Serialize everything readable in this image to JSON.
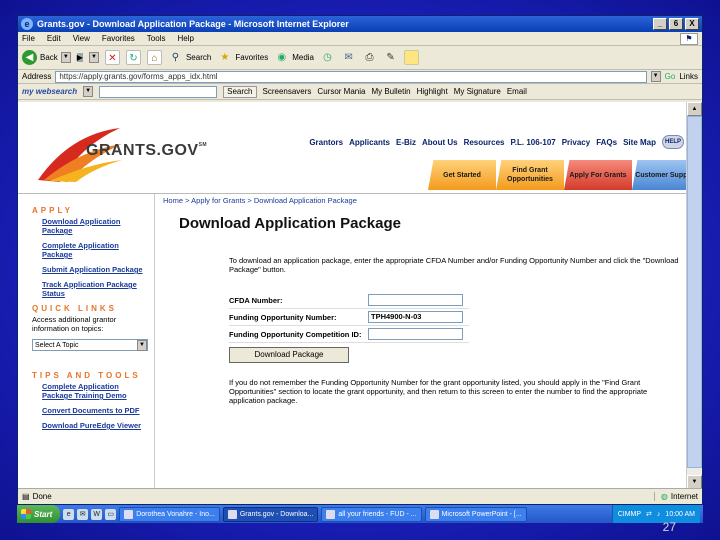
{
  "window": {
    "title": "Grants.gov - Download Application Package - Microsoft Internet Explorer",
    "minimize": "_",
    "restore": "6",
    "close": "X"
  },
  "menu": [
    "File",
    "Edit",
    "View",
    "Favorites",
    "Tools",
    "Help"
  ],
  "toolbar": {
    "back": "Back",
    "search": "Search",
    "favorites": "Favorites",
    "media": "Media"
  },
  "address": {
    "label": "Address",
    "url": "https://apply.grants.gov/forms_apps_idx.html",
    "go": "Go",
    "links": "Links"
  },
  "links_toolbar": {
    "websearch": "my websearch",
    "search_btn": "Search",
    "items": [
      "Screensavers",
      "Cursor Mania",
      "My Bulletin",
      "Highlight",
      "My Signature",
      "Email"
    ]
  },
  "site": {
    "logo_text": "GRANTS.GOV",
    "logo_mark": "SM",
    "topnav": [
      "Grantors",
      "Applicants",
      "E-Biz",
      "About Us",
      "Resources",
      "P.L. 106-107",
      "Privacy",
      "FAQs",
      "Site Map"
    ],
    "help": "HELP",
    "tabs": [
      {
        "label": "Get Started",
        "color": "#f39a1d"
      },
      {
        "label": "Find Grant Opportunities",
        "color": "#f39a1d"
      },
      {
        "label": "Apply For Grants",
        "color": "#d43a2a"
      },
      {
        "label": "Customer Support",
        "color": "#4a86d4"
      }
    ]
  },
  "leftnav": {
    "apply_header": "APPLY",
    "apply_links": [
      "Download Application Package",
      "Complete Application Package",
      "Submit Application Package",
      "Track Application Package Status"
    ],
    "quick_header": "QUICK LINKS",
    "quick_text": "Access additional grantor information on topics:",
    "topic_select": "Select A Topic",
    "tips_header": "TIPS AND TOOLS",
    "tips_links": [
      "Complete Application Package Training Demo",
      "Convert Documents to PDF",
      "Download PureEdge Viewer"
    ]
  },
  "main": {
    "breadcrumb": "Home > Apply for Grants > Download Application Package",
    "title": "Download Application Package",
    "intro": "To download an application package, enter the appropriate CFDA Number and/or Funding Opportunity Number and click the \"Download Package\" button.",
    "fields": [
      {
        "label": "CFDA Number:",
        "value": ""
      },
      {
        "label": "Funding Opportunity Number:",
        "value": "TPH4900-N-03"
      },
      {
        "label": "Funding Opportunity Competition ID:",
        "value": ""
      }
    ],
    "download_button": "Download Package",
    "note": "If you do not remember the Funding Opportunity Number for the grant opportunity listed, you should apply in the \"Find Grant Opportunities\" section to locate the grant opportunity, and then return to this screen to enter the number to find the appropriate application package."
  },
  "status": {
    "text": "Done",
    "zone": "Internet"
  },
  "taskbar": {
    "start": "Start",
    "tasks": [
      {
        "label": "Dorothea Vonahre - Ino...",
        "active": false
      },
      {
        "label": "Grants.gov - Downloa...",
        "active": true
      },
      {
        "label": "all your friends - FUD - ...",
        "active": false
      },
      {
        "label": "Microsoft PowerPoint - [...",
        "active": false
      }
    ],
    "tray_label": "CIMMP",
    "time": "10:00 AM"
  },
  "slide_number": "27"
}
